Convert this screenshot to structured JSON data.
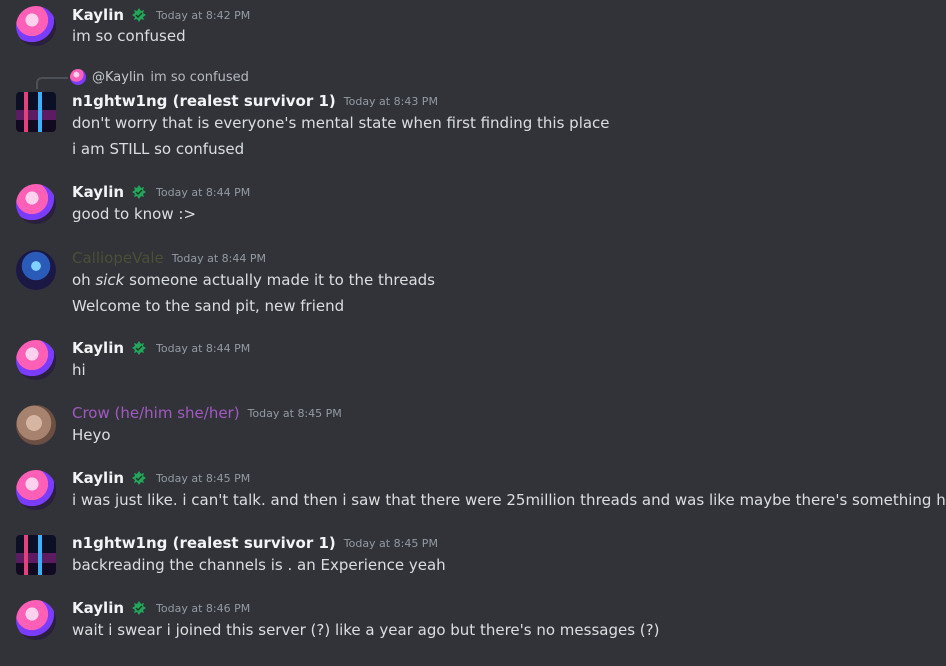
{
  "messages": [
    {
      "author": "Kaylin",
      "time": "Today at 8:42 PM",
      "lines": [
        "im so confused"
      ]
    },
    {
      "reply": {
        "author": "@Kaylin",
        "text": "im so confused"
      },
      "author": "n1ghtw1ng (realest survivor 1)",
      "time": "Today at 8:43 PM",
      "lines": [
        "don't worry that is everyone's mental state when first finding this place",
        "i am STILL so confused"
      ]
    },
    {
      "author": "Kaylin",
      "time": "Today at 8:44 PM",
      "lines": [
        "good to know :>"
      ]
    },
    {
      "author": "CalliopeVale",
      "time": "Today at 8:44 PM",
      "lines": [
        "oh ",
        "sick",
        " someone actually made it to the threads",
        "Welcome to the sand pit, new friend"
      ]
    },
    {
      "author": "Kaylin",
      "time": "Today at 8:44 PM",
      "lines": [
        "hi"
      ]
    },
    {
      "author": "Crow (he/him she/her)",
      "time": "Today at 8:45 PM",
      "lines": [
        "Heyo"
      ]
    },
    {
      "author": "Kaylin",
      "time": "Today at 8:45 PM",
      "lines": [
        "i was just like. i can't talk. and then i saw that there were 25million threads and was like maybe there's something here"
      ]
    },
    {
      "author": "n1ghtw1ng (realest survivor 1)",
      "time": "Today at 8:45 PM",
      "lines": [
        "backreading the channels is . an Experience yeah"
      ]
    },
    {
      "author": "Kaylin",
      "time": "Today at 8:46 PM",
      "lines": [
        "wait i swear i joined this server (?) like a year ago but there's no messages (?)"
      ]
    }
  ],
  "colors": {
    "background": "#313338",
    "badge": "#23a55a",
    "calliope_name": "#4a4f36",
    "crow_name": "#a25ac2"
  },
  "icons": {
    "badge": "badge-icon"
  }
}
